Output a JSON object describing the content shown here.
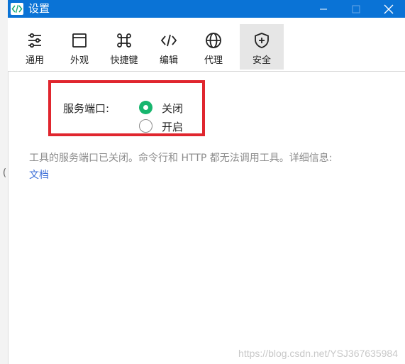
{
  "window": {
    "title": "设置",
    "buttons": {
      "minimize": "minimize",
      "maximize": "maximize",
      "close": "close"
    }
  },
  "left_fragment": "(",
  "toolbar": {
    "tabs": [
      {
        "label": "通用",
        "icon": "sliders-icon"
      },
      {
        "label": "外观",
        "icon": "window-icon"
      },
      {
        "label": "快捷键",
        "icon": "command-key-icon"
      },
      {
        "label": "编辑",
        "icon": "code-icon"
      },
      {
        "label": "代理",
        "icon": "globe-icon"
      },
      {
        "label": "安全",
        "icon": "shield-plus-icon",
        "active": true
      }
    ]
  },
  "security": {
    "port_label": "服务端口:",
    "options": [
      {
        "label": "关闭",
        "selected": true
      },
      {
        "label": "开启",
        "selected": false
      }
    ],
    "info_text": "工具的服务端口已关闭。命令行和 HTTP 都无法调用工具。详细信息:",
    "doc_link": "文档"
  },
  "watermark": "https://blog.csdn.net/YSJ367635984",
  "colors": {
    "titlebar": "#0a73d6",
    "highlight_box": "#e0262e",
    "radio_selected": "#17b66e",
    "link": "#3d6fd8",
    "active_tab_bg": "#e6e6e6"
  }
}
